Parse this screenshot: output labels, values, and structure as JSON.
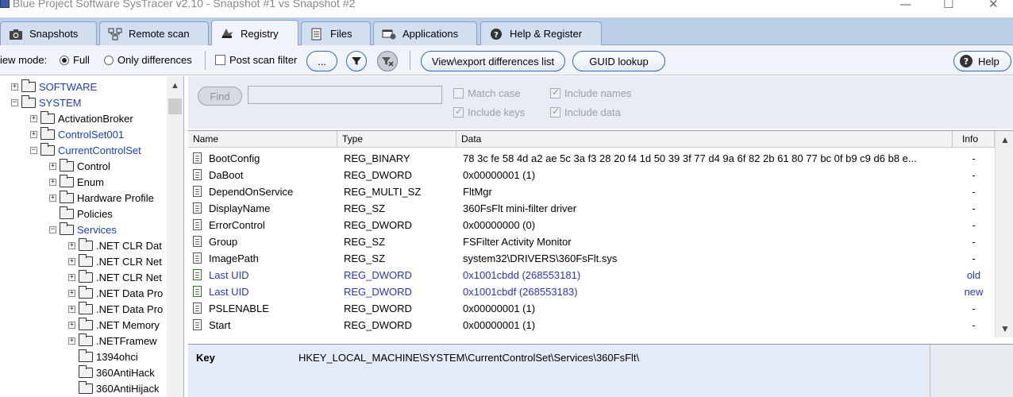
{
  "window": {
    "title": "Blue Project Software SysTracer v2.10 - Snapshot #1 vs Snapshot #2",
    "minimize": "—",
    "maximize": "☐",
    "close": "✕"
  },
  "tabs": [
    {
      "label": "Snapshots",
      "icon": "camera-icon"
    },
    {
      "label": "Remote scan",
      "icon": "network-icon"
    },
    {
      "label": "Registry",
      "icon": "registry-icon",
      "active": true
    },
    {
      "label": "Files",
      "icon": "file-icon"
    },
    {
      "label": "Applications",
      "icon": "applications-icon"
    },
    {
      "label": "Help & Register",
      "icon": "help-icon"
    }
  ],
  "toolbar": {
    "view_mode_label": "iew mode:",
    "full_label": "Full",
    "only_diff_label": "Only differences",
    "post_scan_label": "Post scan filter",
    "ellipsis_label": "...",
    "view_export_label": "View\\export differences list",
    "guid_label": "GUID lookup",
    "help_label": "Help"
  },
  "tree": {
    "items": [
      {
        "label": "SOFTWARE",
        "pm": "+",
        "blue": true
      },
      {
        "label": "SYSTEM",
        "pm": "−",
        "blue": true
      },
      {
        "label": "ActivationBroker",
        "pm": "+",
        "blue": false
      },
      {
        "label": "ControlSet001",
        "pm": "+",
        "blue": true
      },
      {
        "label": "CurrentControlSet",
        "pm": "−",
        "blue": true
      },
      {
        "label": "Control",
        "pm": "+",
        "blue": false
      },
      {
        "label": "Enum",
        "pm": "+",
        "blue": false
      },
      {
        "label": "Hardware Profile",
        "pm": "+",
        "blue": false
      },
      {
        "label": "Policies",
        "pm": "",
        "blue": false
      },
      {
        "label": "Services",
        "pm": "−",
        "blue": true
      },
      {
        "label": ".NET CLR Dat",
        "pm": "+",
        "blue": false
      },
      {
        "label": ".NET CLR Net",
        "pm": "+",
        "blue": false
      },
      {
        "label": ".NET CLR Net",
        "pm": "+",
        "blue": false
      },
      {
        "label": ".NET Data Pro",
        "pm": "+",
        "blue": false
      },
      {
        "label": ".NET Data Pro",
        "pm": "+",
        "blue": false
      },
      {
        "label": ".NET Memory",
        "pm": "+",
        "blue": false
      },
      {
        "label": ".NETFramew",
        "pm": "+",
        "blue": false
      },
      {
        "label": "1394ohci",
        "pm": "",
        "blue": false
      },
      {
        "label": "360AntiHack",
        "pm": "",
        "blue": false
      },
      {
        "label": "360AntiHijack",
        "pm": "",
        "blue": false
      }
    ]
  },
  "find": {
    "button_label": "Find",
    "match_case_label": "Match case",
    "include_names_label": "Include names",
    "include_keys_label": "Include keys",
    "include_data_label": "Include data"
  },
  "table": {
    "headers": {
      "name": "Name",
      "type": "Type",
      "data": "Data",
      "info": "Info"
    },
    "rows": [
      {
        "name": "BootConfig",
        "type": "REG_BINARY",
        "data": "78 3c fe 58 4d a2 ae 5c 3a f3 28 20 f4 1d 50 39 3f 77 d4 9a 6f 82 2b 61 80 77 bc 0f b9 c9 d6 b8 e...",
        "info": "-",
        "diff": false
      },
      {
        "name": "DaBoot",
        "type": "REG_DWORD",
        "data": "0x00000001 (1)",
        "info": "-",
        "diff": false
      },
      {
        "name": "DependOnService",
        "type": "REG_MULTI_SZ",
        "data": "FltMgr",
        "info": "-",
        "diff": false
      },
      {
        "name": "DisplayName",
        "type": "REG_SZ",
        "data": "360FsFlt mini-filter driver",
        "info": "-",
        "diff": false
      },
      {
        "name": "ErrorControl",
        "type": "REG_DWORD",
        "data": "0x00000000 (0)",
        "info": "-",
        "diff": false
      },
      {
        "name": "Group",
        "type": "REG_SZ",
        "data": "FSFilter Activity Monitor",
        "info": "-",
        "diff": false
      },
      {
        "name": "ImagePath",
        "type": "REG_SZ",
        "data": "system32\\DRIVERS\\360FsFlt.sys",
        "info": "-",
        "diff": false
      },
      {
        "name": "Last UID",
        "type": "REG_DWORD",
        "data": "0x1001cbdd (268553181)",
        "info": "old",
        "diff": true
      },
      {
        "name": "Last UID",
        "type": "REG_DWORD",
        "data": "0x1001cbdf (268553183)",
        "info": "new",
        "diff": true
      },
      {
        "name": "PSLENABLE",
        "type": "REG_DWORD",
        "data": "0x00000001 (1)",
        "info": "-",
        "diff": false
      },
      {
        "name": "Start",
        "type": "REG_DWORD",
        "data": "0x00000001 (1)",
        "info": "-",
        "diff": false
      }
    ]
  },
  "keybar": {
    "label": "Key",
    "value": "HKEY_LOCAL_MACHINE\\SYSTEM\\CurrentControlSet\\Services\\360FsFlt\\"
  },
  "colors": {
    "accent_blue": "#1a3fb5",
    "diff_text": "#2836b0",
    "tab_bar": "#bcd0ea"
  }
}
